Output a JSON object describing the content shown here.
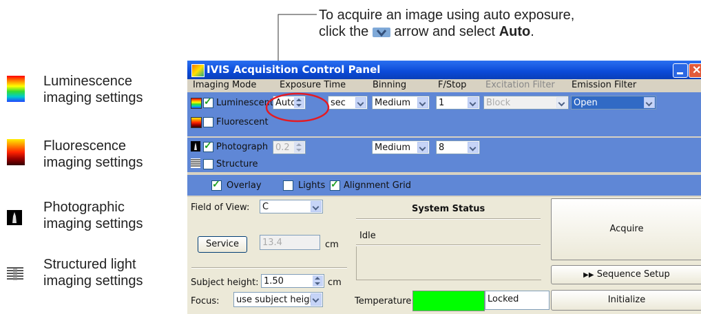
{
  "callout": {
    "line1": "To acquire an image using auto exposure,",
    "line2_pre": "click the",
    "line2_mid": "arrow and select",
    "line2_bold": "Auto",
    "line2_end": "."
  },
  "legend": [
    {
      "icon": "luminescence-icon",
      "line1": "Luminescence",
      "line2": "imaging settings"
    },
    {
      "icon": "fluorescence-icon",
      "line1": "Fluorescence",
      "line2": "imaging settings"
    },
    {
      "icon": "photograph-icon",
      "line1": "Photographic",
      "line2": "imaging settings"
    },
    {
      "icon": "structured-light-icon",
      "line1": "Structured light",
      "line2": "imaging settings"
    }
  ],
  "window": {
    "title": "IVIS Acquisition Control Panel",
    "headers": {
      "imaging_mode": "Imaging Mode",
      "exposure_time": "Exposure Time",
      "binning": "Binning",
      "fstop": "F/Stop",
      "excitation_filter": "Excitation Filter",
      "emission_filter": "Emission Filter"
    },
    "luminescent": {
      "label": "Luminescent",
      "exposure": "Auto",
      "units": "sec",
      "binning": "Medium",
      "fstop": "1",
      "excitation": "Block",
      "emission": "Open",
      "checked": true
    },
    "fluorescent": {
      "label": "Fluorescent",
      "checked": false
    },
    "photograph": {
      "label": "Photograph",
      "exposure": "0.2",
      "binning": "Medium",
      "fstop": "8",
      "checked": true
    },
    "structure": {
      "label": "Structure",
      "checked": false
    },
    "overlay": {
      "label": "Overlay",
      "checked": true
    },
    "lights": {
      "label": "Lights",
      "checked": false
    },
    "alignment_grid": {
      "label": "Alignment Grid",
      "checked": true
    },
    "field_of_view": {
      "label": "Field of View:",
      "value": "C"
    },
    "service": {
      "label": "Service",
      "value": "13.4",
      "unit": "cm"
    },
    "subject_height": {
      "label": "Subject height:",
      "value": "1.50",
      "unit": "cm"
    },
    "focus": {
      "label": "Focus:",
      "value": "use subject height"
    },
    "system_status": {
      "title": "System Status",
      "status": "Idle"
    },
    "temperature": {
      "label": "Temperature:",
      "state": "Locked",
      "color": "#00ff00"
    },
    "buttons": {
      "acquire": "Acquire",
      "sequence_setup": "Sequence Setup",
      "initialize": "Initialize"
    }
  }
}
